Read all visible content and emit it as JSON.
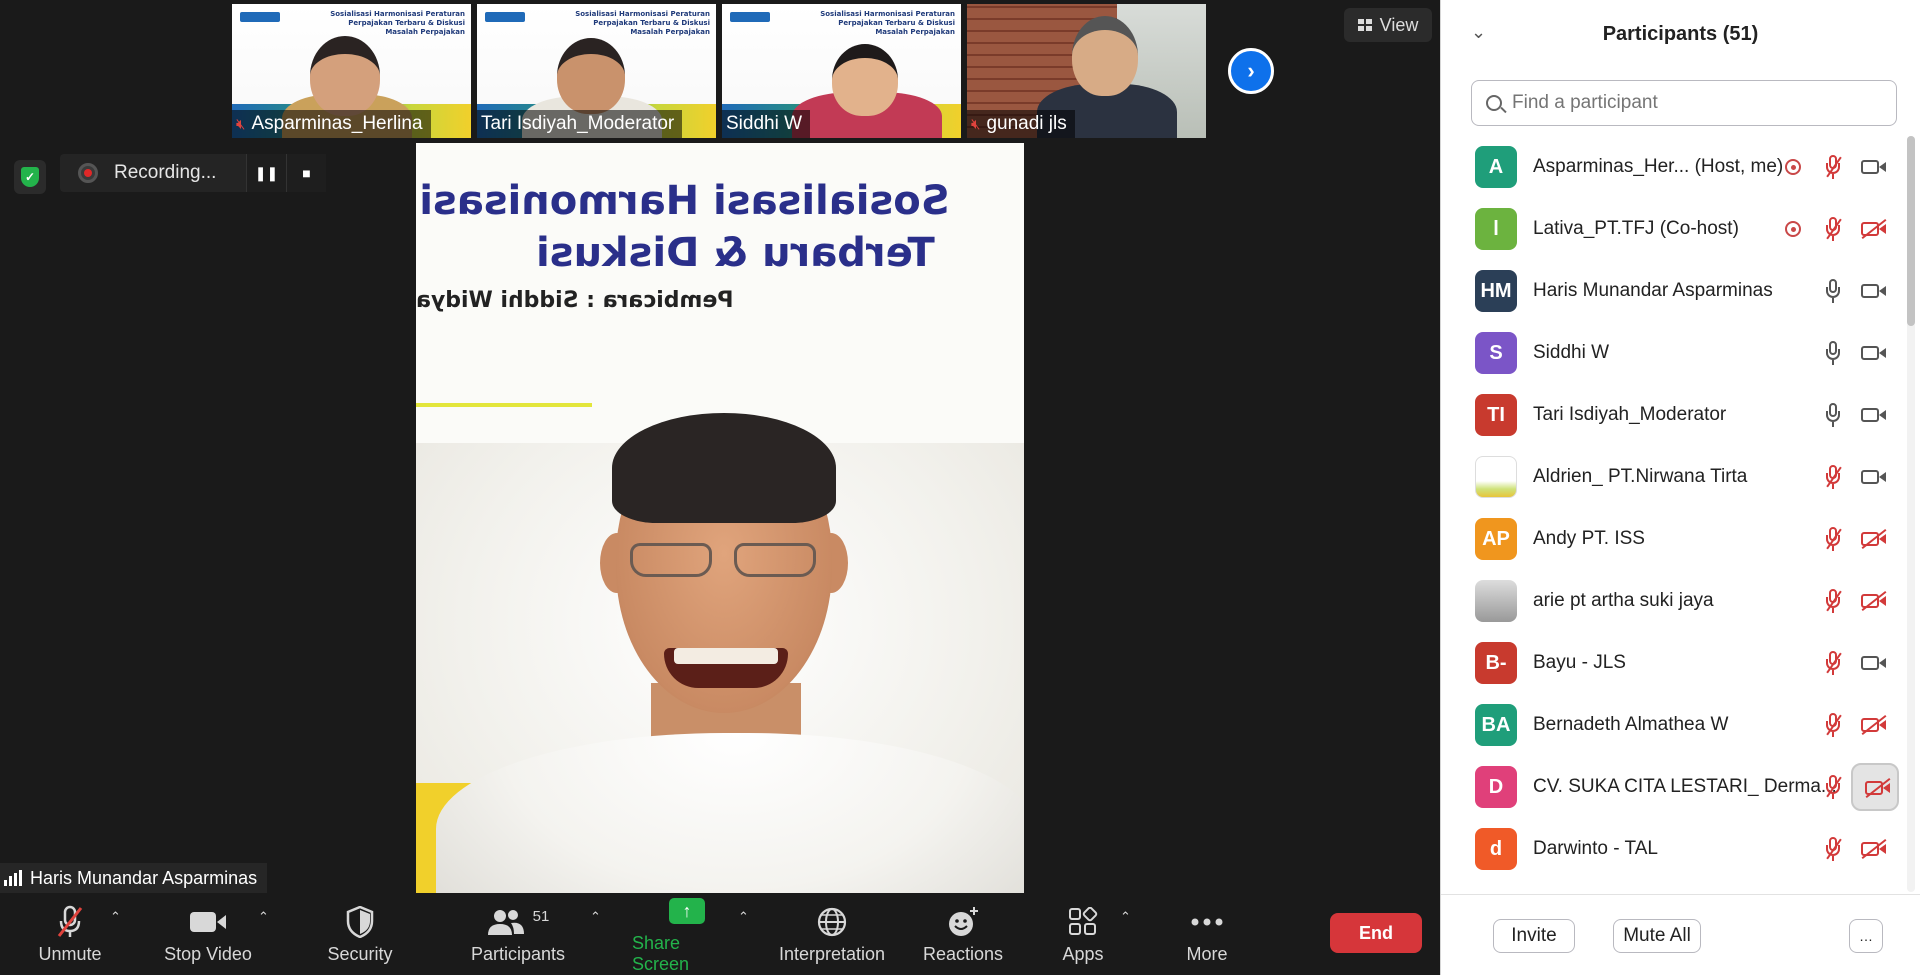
{
  "view_button": {
    "label": "View"
  },
  "thumbnails": [
    {
      "name": "Asparminas_Herlina",
      "muted": true,
      "slide_text": "Sosialisasi Harmonisasi Peraturan Perpajakan Terbaru & Diskusi Masalah Perpajakan"
    },
    {
      "name": "Tari Isdiyah_Moderator",
      "muted": false,
      "slide_text": "Sosialisasi Harmonisasi Peraturan Perpajakan Terbaru & Diskusi Masalah Perpajakan"
    },
    {
      "name": "Siddhi W",
      "muted": false,
      "slide_text": "Sosialisasi Harmonisasi Peraturan Perpajakan Terbaru & Diskusi Masalah Perpajakan"
    },
    {
      "name": "gunadi jls",
      "muted": true,
      "slide_text": ""
    }
  ],
  "recording": {
    "label": "Recording...",
    "pause_icon": "pause-icon",
    "stop_icon": "stop-icon"
  },
  "speaker": {
    "name": "Haris Munandar Asparminas",
    "background_lines": [
      "Sosialisasi Harmonisasi P",
      "Terbaru & Diskusi",
      "Pembicara : Siddhi  Widya"
    ]
  },
  "toolbar": {
    "unmute": "Unmute",
    "stop_video": "Stop Video",
    "security": "Security",
    "participants": "Participants",
    "participants_count": "51",
    "share_screen": "Share Screen",
    "interpretation": "Interpretation",
    "reactions": "Reactions",
    "apps": "Apps",
    "more": "More",
    "end": "End"
  },
  "panel": {
    "title": "Participants (51)",
    "search_placeholder": "Find a participant",
    "invite": "Invite",
    "mute_all": "Mute All",
    "more": "…",
    "participants": [
      {
        "initials": "A",
        "color": "#1f9e7a",
        "name": "Asparminas_Her...  (Host, me)",
        "recording": true,
        "mic": "muted",
        "cam": "on"
      },
      {
        "initials": "l",
        "color": "#6cb33f",
        "name": "Lativa_PT.TFJ (Co-host)",
        "recording": true,
        "mic": "muted",
        "cam": "off"
      },
      {
        "initials": "HM",
        "color": "#2b3f57",
        "name": "Haris Munandar Asparminas",
        "recording": false,
        "mic": "on",
        "cam": "on"
      },
      {
        "initials": "S",
        "color": "#7b55c7",
        "name": "Siddhi W",
        "recording": false,
        "mic": "on",
        "cam": "on"
      },
      {
        "initials": "TI",
        "color": "#c83a2e",
        "name": "Tari Isdiyah_Moderator",
        "recording": false,
        "mic": "on",
        "cam": "on"
      },
      {
        "initials": "",
        "color": "slide",
        "name": "Aldrien_ PT.Nirwana Tirta",
        "recording": false,
        "mic": "muted",
        "cam": "on"
      },
      {
        "initials": "AP",
        "color": "#f0961e",
        "name": "Andy PT. ISS",
        "recording": false,
        "mic": "muted",
        "cam": "off"
      },
      {
        "initials": "",
        "color": "photo",
        "name": "arie pt artha suki jaya",
        "recording": false,
        "mic": "muted",
        "cam": "off"
      },
      {
        "initials": "B-",
        "color": "#c83a2e",
        "name": "Bayu - JLS",
        "recording": false,
        "mic": "muted",
        "cam": "on"
      },
      {
        "initials": "BA",
        "color": "#1f9e7a",
        "name": "Bernadeth Almathea W",
        "recording": false,
        "mic": "muted",
        "cam": "off"
      },
      {
        "initials": "D",
        "color": "#e0407a",
        "name": "CV. SUKA CITA LESTARI_ Derma...",
        "recording": false,
        "mic": "muted",
        "cam": "off-hover"
      },
      {
        "initials": "d",
        "color": "#f05a28",
        "name": "Darwinto - TAL",
        "recording": false,
        "mic": "muted",
        "cam": "off"
      }
    ]
  }
}
